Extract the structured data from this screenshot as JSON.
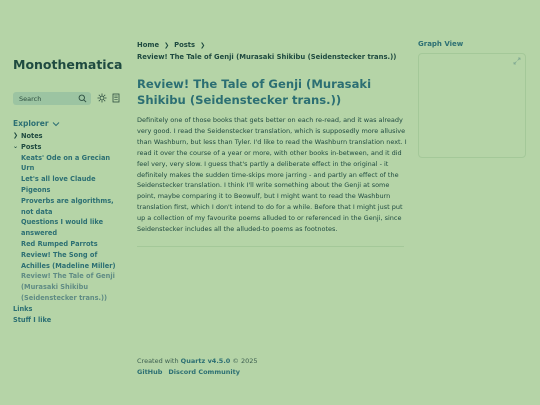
{
  "site": {
    "title": "Monothematica"
  },
  "search": {
    "label": "Search"
  },
  "explorer": {
    "title": "Explorer",
    "notes_label": "Notes",
    "posts_label": "Posts",
    "posts": [
      "Keats' Ode on a Grecian Urn",
      "Let's all love Claude",
      "Pigeons",
      "Proverbs are algorithms, not data",
      "Questions I would like answered",
      "Red Rumped Parrots",
      "Review! The Song of Achilles (Madeline Miller)",
      "Review! The Tale of Genji (Murasaki Shikibu (Seidenstecker trans.))"
    ],
    "links_label": "Links",
    "stuff_label": "Stuff I like"
  },
  "breadcrumb": {
    "home": "Home",
    "posts": "Posts",
    "current": "Review! The Tale of Genji (Murasaki Shikibu (Seidenstecker trans.))"
  },
  "article": {
    "title": "Review! The Tale of Genji (Murasaki Shikibu (Seidenstecker trans.))",
    "body": "Definitely one of those books that gets better on each re-read, and it was already very good. I read the Seidenstecker translation, which is supposedly more allusive than Washburn, but less than Tyler. I'd like to read the Washburn translation next. I read it over the course of a year or more, with other books in-between, and it did feel very, very slow. I guess that's partly a deliberate effect in the original - it definitely makes the sudden time-skips more jarring - and partly an effect of the Seidenstecker translation. I think I'll write something about the Genji at some point, maybe comparing it to Beowulf, but I might want to read the Washburn translation first, which I don't intend to do for a while. Before that I might just put up a collection of my favourite poems alluded to or referenced in the Genji, since Seidenstecker includes all the alluded-to poems as footnotes."
  },
  "footer": {
    "created_prefix": "Created with",
    "quartz": "Quartz v4.5.0",
    "year": "© 2025",
    "github": "GitHub",
    "discord": "Discord Community"
  },
  "graph": {
    "title": "Graph View"
  },
  "icons": {
    "search": "search-icon",
    "theme": "sun-icon",
    "reader": "reader-mode-icon",
    "explorer_toggle": "chevron-down-icon",
    "graph_expand": "expand-icon"
  }
}
